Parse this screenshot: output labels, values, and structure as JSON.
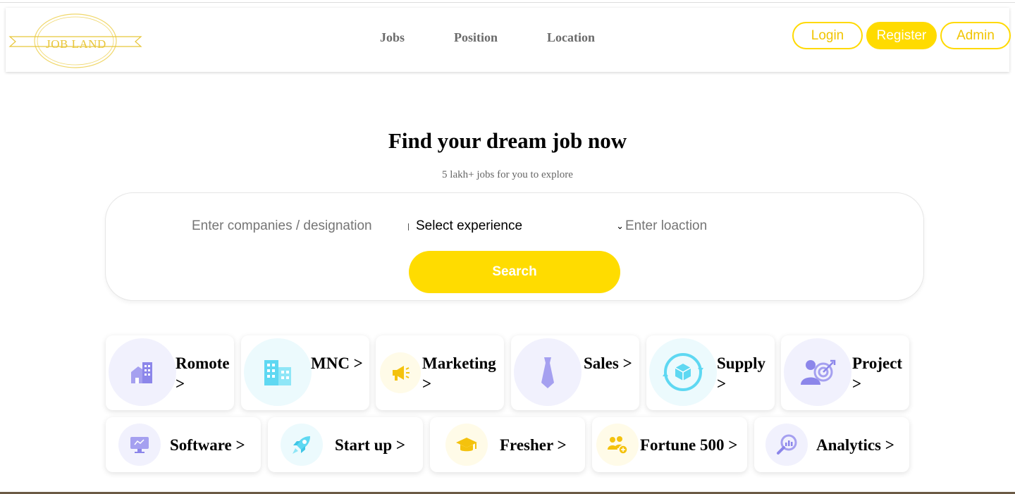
{
  "brand": {
    "logo_text": "JOB LAND"
  },
  "nav": {
    "links": [
      "Jobs",
      "Position",
      "Location"
    ]
  },
  "auth": {
    "login": "Login",
    "register": "Register",
    "admin": "Admin"
  },
  "hero": {
    "title": "Find your dream job now",
    "subtitle": "5 lakh+ jobs for you to explore"
  },
  "search": {
    "company_placeholder": "Enter companies / designation",
    "experience_selected": "Select experience",
    "location_placeholder": "Enter loaction",
    "button": "Search"
  },
  "categories_row1": [
    {
      "label": "Romote >",
      "icon": "building-icon"
    },
    {
      "label": "MNC >",
      "icon": "office-tower-icon"
    },
    {
      "label": "Marketing >",
      "icon": "megaphone-icon"
    },
    {
      "label": "Sales >",
      "icon": "tie-icon"
    },
    {
      "label": "Supply >",
      "icon": "supply-cycle-icon"
    },
    {
      "label": "Project >",
      "icon": "target-person-icon"
    }
  ],
  "categories_row2": [
    {
      "label": "Software >",
      "icon": "monitor-icon"
    },
    {
      "label": "Start up >",
      "icon": "rocket-icon"
    },
    {
      "label": "Fresher >",
      "icon": "graduation-cap-icon"
    },
    {
      "label": "Fortune 500 >",
      "icon": "team-icon"
    },
    {
      "label": "Analytics >",
      "icon": "magnifier-chart-icon"
    }
  ],
  "colors": {
    "accent": "#ffdb00",
    "icon_lavender": "#a5a0f0",
    "icon_cyan": "#5ed8f2",
    "icon_yellow": "#f4c20d"
  }
}
